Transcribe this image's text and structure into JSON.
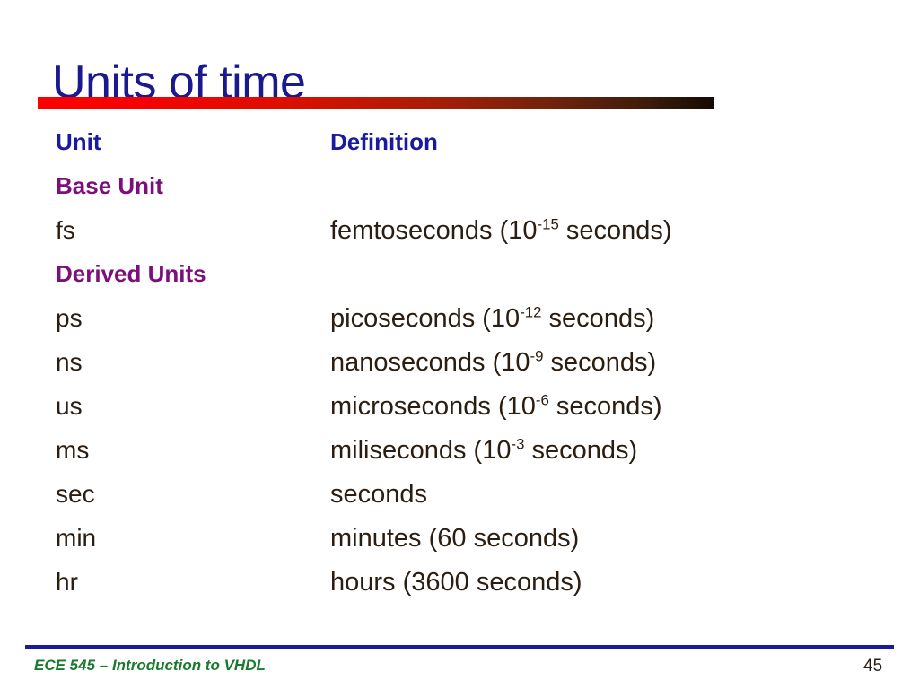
{
  "slide": {
    "title": "Units of time",
    "title_color": "#1a1a8e",
    "rule_color_start": "#ff0000",
    "rule_color_end": "#140a03"
  },
  "table": {
    "header": {
      "unit": "Unit",
      "definition": "Definition",
      "color": "#1a1aa0"
    },
    "group_color": "#7c0f7c",
    "body_color": "#2b1d10",
    "rows": [
      {
        "kind": "header",
        "unit": "Unit",
        "def_pre": "Definition",
        "def_sup": "",
        "def_post": ""
      },
      {
        "kind": "group",
        "unit": "Base Unit",
        "def_pre": "",
        "def_sup": "",
        "def_post": ""
      },
      {
        "kind": "data",
        "unit": "fs",
        "def_pre": "femtoseconds (10",
        "def_sup": "-15",
        "def_post": " seconds)"
      },
      {
        "kind": "group",
        "unit": "Derived Units",
        "def_pre": "",
        "def_sup": "",
        "def_post": ""
      },
      {
        "kind": "data",
        "unit": "ps",
        "def_pre": "picoseconds (10",
        "def_sup": "-12",
        "def_post": " seconds)"
      },
      {
        "kind": "data",
        "unit": "ns",
        "def_pre": "nanoseconds (10",
        "def_sup": "-9",
        "def_post": " seconds)"
      },
      {
        "kind": "data",
        "unit": "us",
        "def_pre": "microseconds (10",
        "def_sup": "-6",
        "def_post": " seconds)"
      },
      {
        "kind": "data",
        "unit": "ms",
        "def_pre": "miliseconds (10",
        "def_sup": "-3",
        "def_post": " seconds)"
      },
      {
        "kind": "data",
        "unit": "sec",
        "def_pre": "seconds",
        "def_sup": "",
        "def_post": ""
      },
      {
        "kind": "data",
        "unit": "min",
        "def_pre": "minutes (60 seconds)",
        "def_sup": "",
        "def_post": ""
      },
      {
        "kind": "data",
        "unit": "hr",
        "def_pre": "hours (3600 seconds)",
        "def_sup": "",
        "def_post": ""
      }
    ]
  },
  "footer": {
    "course": "ECE 545 – Introduction to VHDL",
    "page_number": "45",
    "course_color": "#1a7a2e",
    "rule_color": "#1a1a9e"
  }
}
